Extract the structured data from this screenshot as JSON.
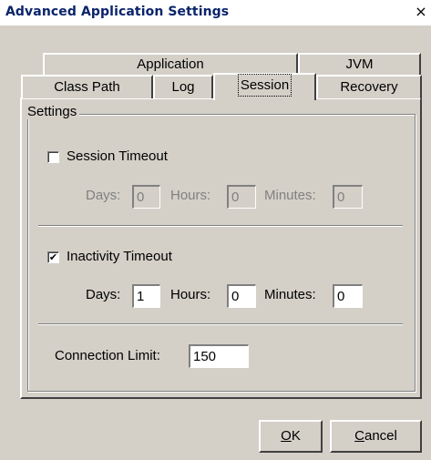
{
  "window": {
    "title": "Advanced Application Settings",
    "close_glyph": "×"
  },
  "tabs": {
    "row_back": [
      {
        "label": "Application"
      },
      {
        "label": "JVM"
      }
    ],
    "row_front": [
      {
        "label": "Class Path"
      },
      {
        "label": "Log"
      },
      {
        "label": "Session",
        "selected": true
      },
      {
        "label": "Recovery"
      }
    ]
  },
  "settings_group": {
    "legend": "Settings",
    "session_timeout": {
      "label": "Session Timeout",
      "checked": false,
      "days_label": "Days:",
      "days_value": "0",
      "hours_label": "Hours:",
      "hours_value": "0",
      "minutes_label": "Minutes:",
      "minutes_value": "0",
      "enabled": false
    },
    "inactivity_timeout": {
      "label": "Inactivity Timeout",
      "checked": true,
      "check_glyph": "✔",
      "days_label": "Days:",
      "days_value": "1",
      "hours_label": "Hours:",
      "hours_value": "0",
      "minutes_label": "Minutes:",
      "minutes_value": "0",
      "enabled": true
    },
    "connection_limit": {
      "label": "Connection Limit:",
      "value": "150"
    }
  },
  "buttons": {
    "ok_mnemonic": "O",
    "ok_rest": "K",
    "cancel_mnemonic": "C",
    "cancel_rest": "ancel"
  },
  "colors": {
    "dialog_background": "#d4d0c8",
    "title_text": "#0a246a",
    "disabled_text": "#808080"
  }
}
